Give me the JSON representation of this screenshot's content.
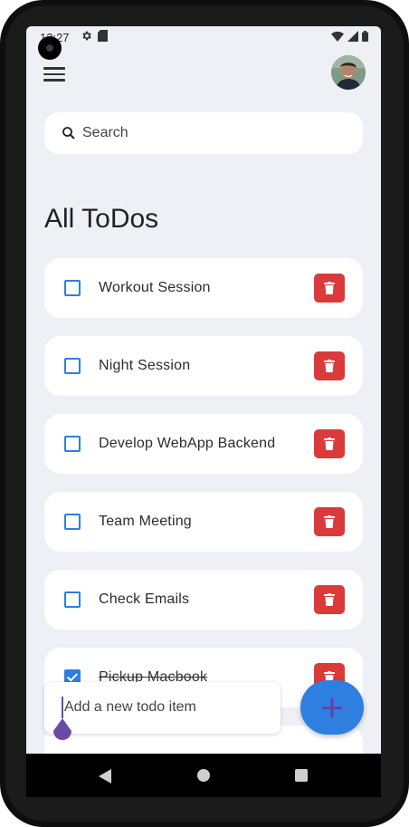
{
  "status_bar": {
    "time": "12:27"
  },
  "search": {
    "placeholder": "Search"
  },
  "page_title": "All ToDos",
  "todos": [
    {
      "label": "Workout Session",
      "done": false
    },
    {
      "label": "Night Session",
      "done": false
    },
    {
      "label": "Develop WebApp Backend",
      "done": false
    },
    {
      "label": "Team Meeting",
      "done": false
    },
    {
      "label": "Check Emails",
      "done": false
    },
    {
      "label": "Pickup Macbook",
      "done": true
    }
  ],
  "new_todo": {
    "placeholder": "Add a new todo item"
  },
  "fab": {
    "label": "+"
  },
  "colors": {
    "background": "#eff0f6",
    "checkbox": "#2f7fe0",
    "delete": "#db3a3a",
    "fab": "#2f7fe0",
    "fab_plus": "#6a3fa0"
  },
  "icons": {
    "menu": "menu-icon",
    "search": "search-icon",
    "delete": "trash-icon",
    "settings": "gear-icon",
    "sim": "sim-card-icon",
    "wifi": "wifi-icon",
    "signal": "signal-icon",
    "battery": "battery-icon"
  }
}
